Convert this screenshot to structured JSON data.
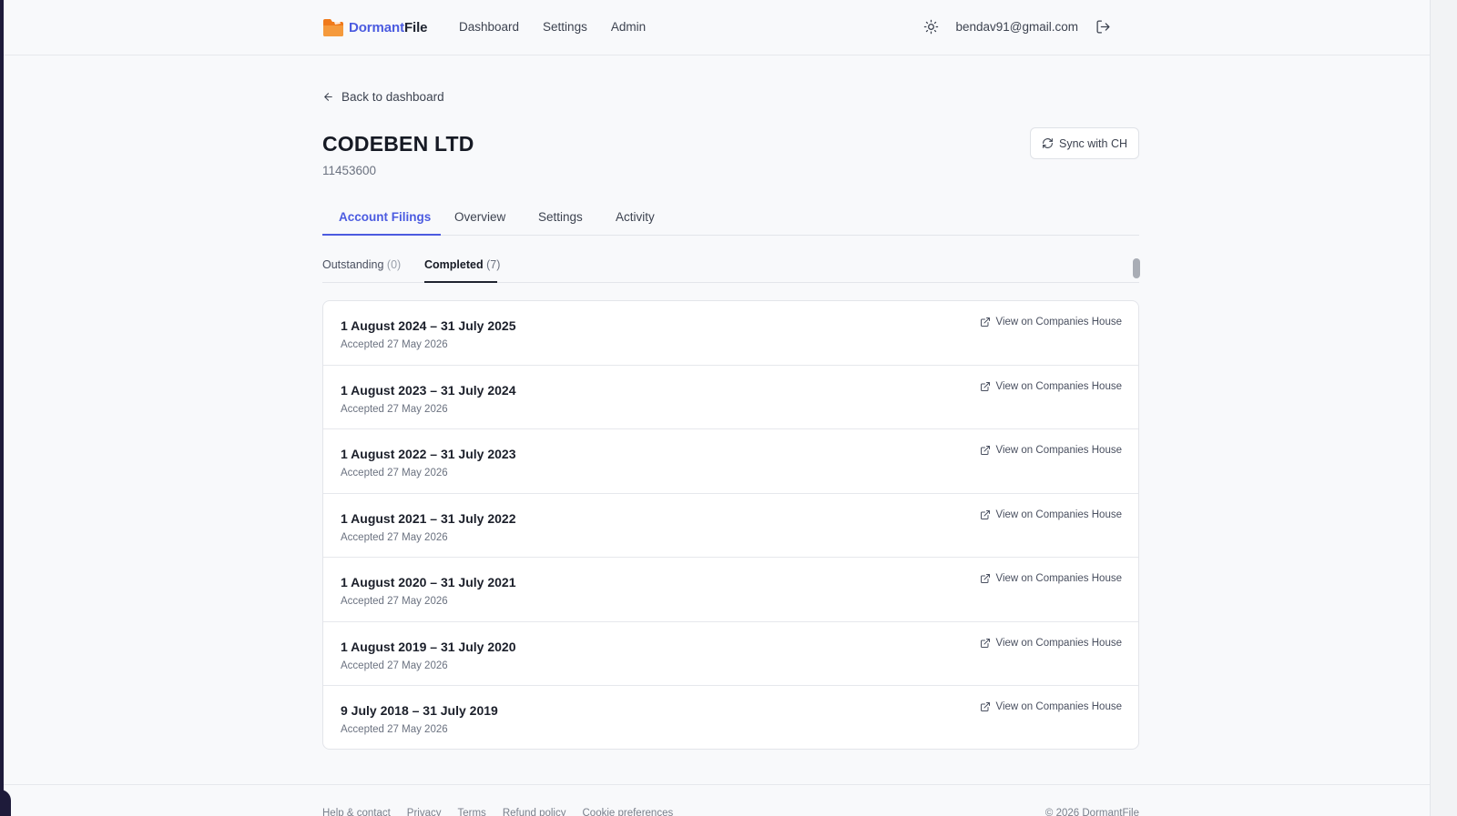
{
  "brand": {
    "name_part1": "Dormant",
    "name_part2": "File"
  },
  "nav": {
    "items": [
      "Dashboard",
      "Settings",
      "Admin"
    ]
  },
  "user": {
    "email": "bendav91@gmail.com"
  },
  "page": {
    "back_label": "Back to dashboard",
    "company_name": "CODEBEN LTD",
    "company_number": "11453600",
    "sync_label": "Sync with CH"
  },
  "tabs": [
    "Account Filings",
    "Overview",
    "Settings",
    "Activity"
  ],
  "subtabs": {
    "outstanding_label": "Outstanding",
    "outstanding_count": "(0)",
    "completed_label": "Completed",
    "completed_count": "(7)"
  },
  "filings": [
    {
      "period": "1 August 2024 – 31 July 2025",
      "accepted": "Accepted 27 May 2026",
      "link": "View on Companies House"
    },
    {
      "period": "1 August 2023 – 31 July 2024",
      "accepted": "Accepted 27 May 2026",
      "link": "View on Companies House"
    },
    {
      "period": "1 August 2022 – 31 July 2023",
      "accepted": "Accepted 27 May 2026",
      "link": "View on Companies House"
    },
    {
      "period": "1 August 2021 – 31 July 2022",
      "accepted": "Accepted 27 May 2026",
      "link": "View on Companies House"
    },
    {
      "period": "1 August 2020 – 31 July 2021",
      "accepted": "Accepted 27 May 2026",
      "link": "View on Companies House"
    },
    {
      "period": "1 August 2019 – 31 July 2020",
      "accepted": "Accepted 27 May 2026",
      "link": "View on Companies House"
    },
    {
      "period": "9 July 2018 – 31 July 2019",
      "accepted": "Accepted 27 May 2026",
      "link": "View on Companies House"
    }
  ],
  "footer": {
    "links": [
      "Help & contact",
      "Privacy",
      "Terms",
      "Refund policy",
      "Cookie preferences"
    ],
    "copyright": "© 2026 DormantFile"
  },
  "colors": {
    "accent": "#4b5be0",
    "logo": "#f07a1a"
  },
  "icons": [
    "folder-logo-icon",
    "sun-icon",
    "logout-icon",
    "arrow-left-icon",
    "refresh-icon",
    "external-link-icon"
  ]
}
